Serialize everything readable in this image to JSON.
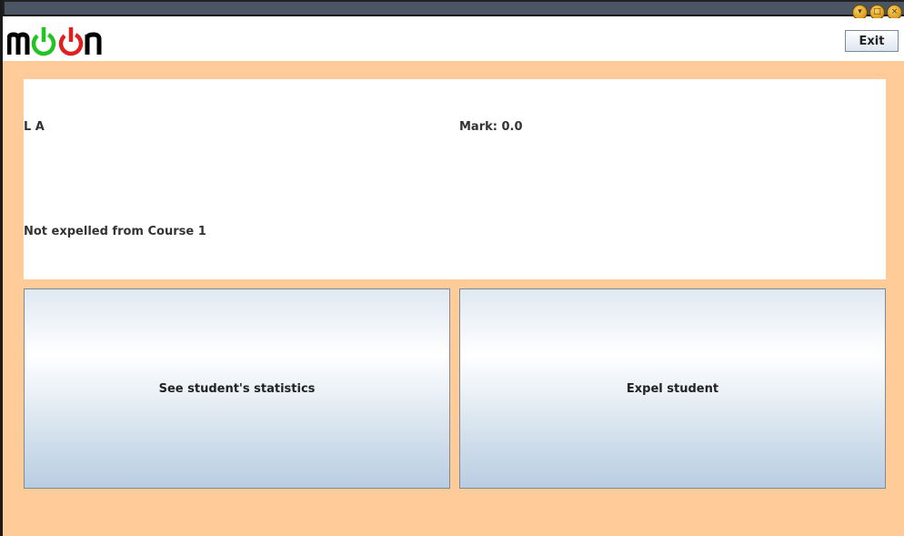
{
  "window": {
    "controls": [
      "minimize-icon",
      "maximize-icon",
      "close-icon"
    ]
  },
  "header": {
    "logo_text": "moon",
    "exit_label": "Exit"
  },
  "student": {
    "name": "L A",
    "mark": "Mark: 0.0",
    "status": "Not expelled from Course 1"
  },
  "actions": {
    "stats_label": "See student's statistics",
    "expel_label": "Expel student"
  },
  "colors": {
    "background": "#ffcc99",
    "panel": "#ffffff",
    "logo_green": "#22c422",
    "logo_red": "#e02020"
  }
}
